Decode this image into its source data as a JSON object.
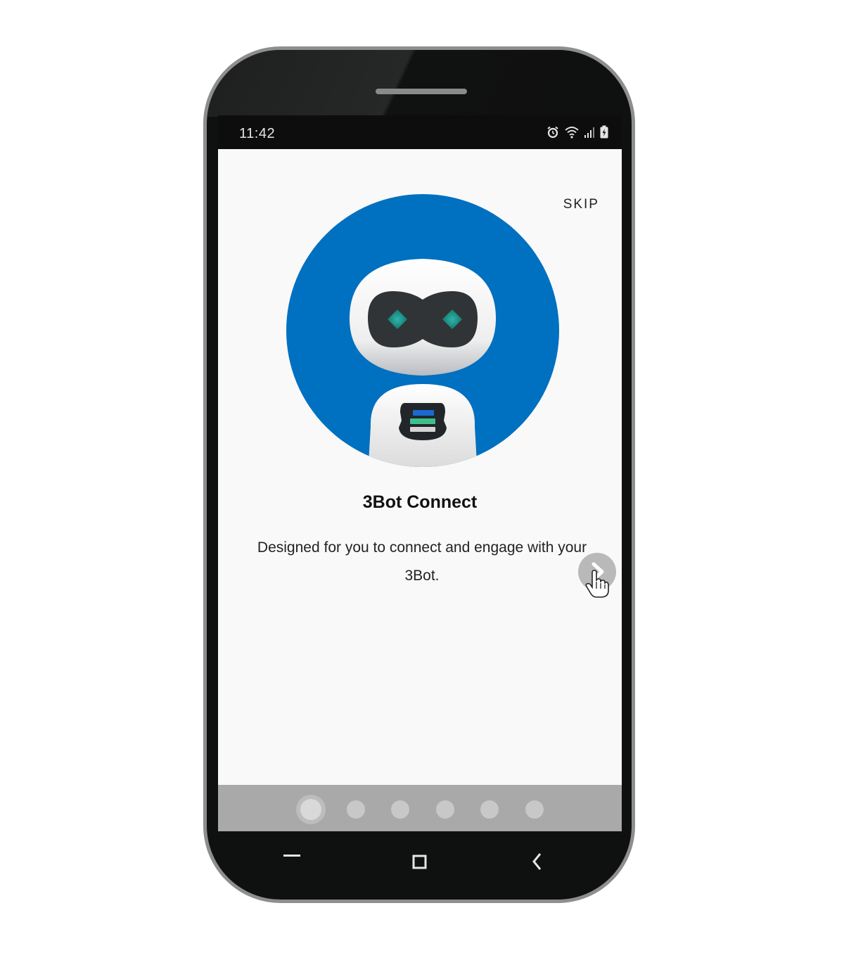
{
  "status_bar": {
    "time": "11:42",
    "icons": [
      "alarm-icon",
      "wifi-icon",
      "signal-icon",
      "battery-charging-icon"
    ]
  },
  "onboarding": {
    "skip_label": "SKIP",
    "logo_icon": "3bot-robot-logo",
    "title": "3Bot Connect",
    "description": "Designed for you to connect and engage with your 3Bot.",
    "next_icon": "chevron-right-icon",
    "page_count": 6,
    "current_page": 1
  },
  "navigation": {
    "recents_icon": "recents-icon",
    "home_icon": "home-square-icon",
    "back_icon": "back-chevron-icon"
  },
  "colors": {
    "brand_blue": "#0070c0",
    "screen_bg": "#f9f9f9",
    "dots_bar": "#a9a9a9",
    "phone_body": "#0f1010"
  }
}
